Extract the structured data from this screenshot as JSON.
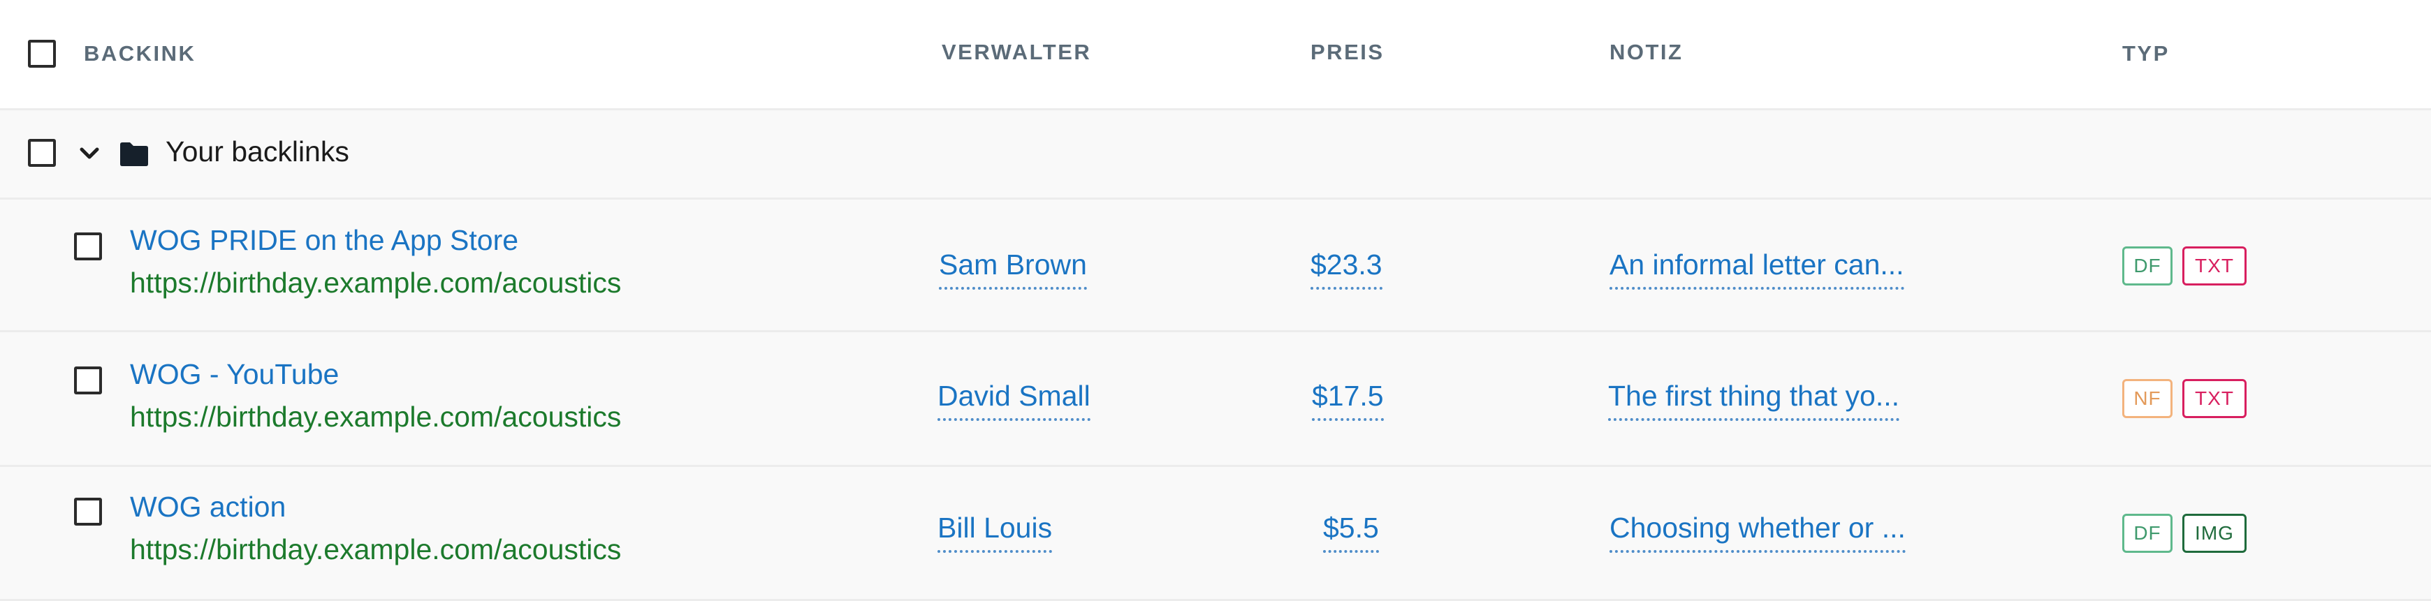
{
  "header": {
    "backlink": "BACKINK",
    "verwalter": "VERWALTER",
    "preis": "PREIS",
    "notiz": "NOTIZ",
    "typ": "TYP"
  },
  "group": {
    "label": "Your backlinks",
    "chevron_icon": "chevron-down-icon",
    "folder_icon": "folder-icon"
  },
  "rows": [
    {
      "title": "WOG PRIDE on the App Store",
      "url": "https://birthday.example.com/acoustics",
      "manager": "Sam Brown",
      "price": "$23.3",
      "note": "An informal letter can...",
      "badges": [
        "DF",
        "TXT"
      ]
    },
    {
      "title": "WOG - YouTube",
      "url": "https://birthday.example.com/acoustics",
      "manager": "David Small",
      "price": "$17.5",
      "note": "The first thing that yo...",
      "badges": [
        "NF",
        "TXT"
      ]
    },
    {
      "title": "WOG action",
      "url": "https://birthday.example.com/acoustics",
      "manager": "Bill Louis",
      "price": "$5.5",
      "note": "Choosing whether or ...",
      "badges": [
        "DF",
        "IMG"
      ]
    }
  ],
  "colors": {
    "link_blue": "#1a74c3",
    "url_green": "#1c7a2c",
    "df": "#3f9a6d",
    "nf": "#e39a5a",
    "txt": "#d81f5f",
    "img": "#1f6b3c"
  }
}
